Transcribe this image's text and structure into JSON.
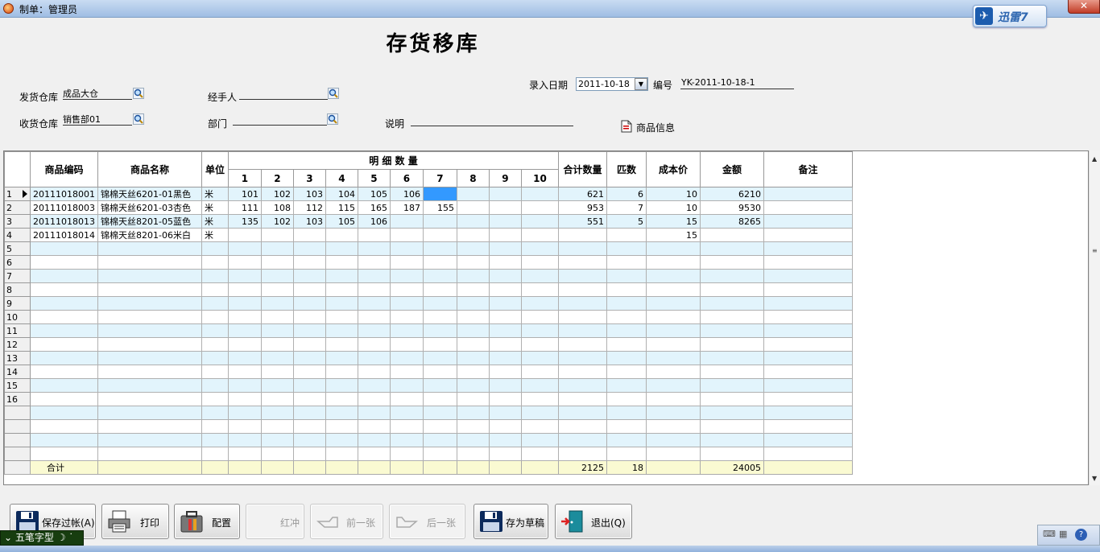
{
  "window": {
    "title": "制单：管理员",
    "close_label": "✕"
  },
  "xunlei": {
    "label": "迅雷7"
  },
  "page_title": "存货移库",
  "form": {
    "entry_date_label": "录入日期",
    "entry_date_value": "2011-10-18",
    "number_label": "编号",
    "number_value": "YK-2011-10-18-1",
    "from_wh_label": "发货仓库",
    "from_wh_value": "成品大仓",
    "handler_label": "经手人",
    "handler_value": "",
    "to_wh_label": "收货仓库",
    "to_wh_value": "销售部01",
    "dept_label": "部门",
    "dept_value": "",
    "note_label": "说明",
    "note_value": "",
    "product_info_label": "商品信息"
  },
  "grid": {
    "headers": {
      "code": "商品编码",
      "name": "商品名称",
      "unit": "单位",
      "detail": "明 细 数 量",
      "sizes": [
        "1",
        "2",
        "3",
        "4",
        "5",
        "6",
        "7",
        "8",
        "9",
        "10"
      ],
      "total_qty": "合计数量",
      "pieces": "匹数",
      "cost": "成本价",
      "amount": "金额",
      "remark": "备注"
    },
    "rows": [
      {
        "n": "1",
        "code": "20111018001",
        "name": "锦棉天丝6201-01黑色",
        "unit": "米",
        "q": [
          "101",
          "102",
          "103",
          "104",
          "105",
          "106",
          "",
          "",
          "",
          ""
        ],
        "total": "621",
        "pieces": "6",
        "cost": "10",
        "amount": "6210",
        "remark": ""
      },
      {
        "n": "2",
        "code": "20111018003",
        "name": "锦棉天丝6201-03杏色",
        "unit": "米",
        "q": [
          "111",
          "108",
          "112",
          "115",
          "165",
          "187",
          "155",
          "",
          "",
          ""
        ],
        "total": "953",
        "pieces": "7",
        "cost": "10",
        "amount": "9530",
        "remark": ""
      },
      {
        "n": "3",
        "code": "20111018013",
        "name": "锦棉天丝8201-05蓝色",
        "unit": "米",
        "q": [
          "135",
          "102",
          "103",
          "105",
          "106",
          "",
          "",
          "",
          "",
          ""
        ],
        "total": "551",
        "pieces": "5",
        "cost": "15",
        "amount": "8265",
        "remark": ""
      },
      {
        "n": "4",
        "code": "20111018014",
        "name": "锦棉天丝8201-06米白",
        "unit": "米",
        "q": [
          "",
          "",
          "",
          "",
          "",
          "",
          "",
          "",
          "",
          ""
        ],
        "total": "",
        "pieces": "",
        "cost": "15",
        "amount": "",
        "remark": ""
      },
      {
        "n": "5"
      },
      {
        "n": "6"
      },
      {
        "n": "7"
      },
      {
        "n": "8"
      },
      {
        "n": "9"
      },
      {
        "n": "10"
      },
      {
        "n": "11"
      },
      {
        "n": "12"
      },
      {
        "n": "13"
      },
      {
        "n": "14"
      },
      {
        "n": "15"
      },
      {
        "n": "16"
      },
      {
        "n": ""
      },
      {
        "n": ""
      },
      {
        "n": ""
      },
      {
        "n": ""
      }
    ],
    "summary": {
      "label": "合计",
      "total": "2125",
      "pieces": "18",
      "amount": "24005"
    }
  },
  "buttons": {
    "save": "保存过帐(A)",
    "print": "打印",
    "config": "配置",
    "reverse": "红冲",
    "prev": "前一张",
    "next": "后一张",
    "draft": "存为草稿",
    "exit": "退出(Q)"
  },
  "ime": {
    "label": "五笔字型"
  },
  "colors": {
    "row_alt": "#e2f4fc",
    "selected_cell": "#3399ff",
    "summary_row": "#fafad2"
  }
}
